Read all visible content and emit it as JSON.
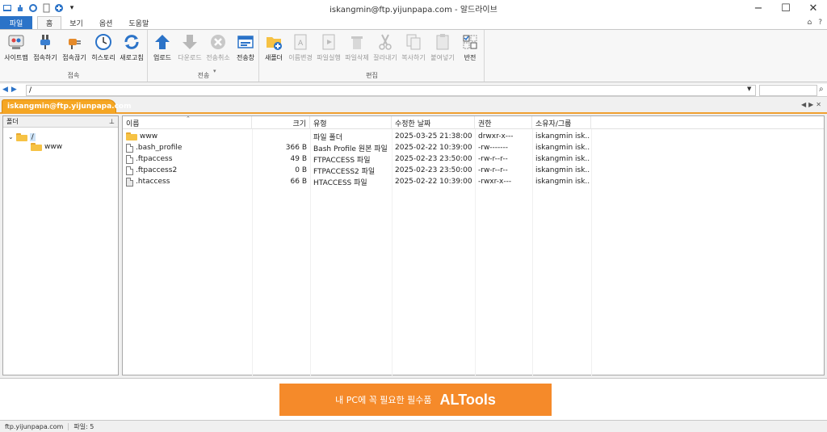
{
  "window": {
    "title": "iskangmin@ftp.yijunpapa.com - 알드라이브"
  },
  "ribbon_tabs": [
    "파일",
    "홈",
    "보기",
    "옵션",
    "도움말"
  ],
  "ribbon": {
    "groups": [
      {
        "label": "접속",
        "buttons": [
          "사이트맵",
          "접속하기",
          "접속끊기",
          "히스토리",
          "새로고침"
        ]
      },
      {
        "label": "전송",
        "buttons": [
          "업로드",
          "다운로드",
          "전송취소",
          "전송창"
        ]
      },
      {
        "label": "편집",
        "buttons": [
          "새폴더",
          "이름변경",
          "파일실행",
          "파일삭제",
          "잘라내기",
          "복사하기",
          "붙여넣기",
          "반전"
        ]
      }
    ]
  },
  "address": {
    "path": "/"
  },
  "session_tab": "iskangmin@ftp.yijunpapa.com",
  "folder_pane": {
    "header": "폴더",
    "pin": "ㅁ",
    "tree": [
      "/",
      "www"
    ]
  },
  "file_list": {
    "columns": [
      "이름",
      "크기",
      "유형",
      "수정한 날짜",
      "권한",
      "소유자/그룹"
    ],
    "rows": [
      {
        "icon": "folder",
        "name": "www",
        "size": "",
        "type": "파일 폴더",
        "modified": "2025-03-25 21:38:00",
        "perm": "drwxr-x---",
        "owner": "iskangmin isk..."
      },
      {
        "icon": "file",
        "name": ".bash_profile",
        "size": "366 B",
        "type": "Bash Profile 원본 파일",
        "modified": "2025-02-22 10:39:00",
        "perm": "-rw-------",
        "owner": "iskangmin isk..."
      },
      {
        "icon": "file",
        "name": ".ftpaccess",
        "size": "49 B",
        "type": "FTPACCESS 파일",
        "modified": "2025-02-23 23:50:00",
        "perm": "-rw-r--r--",
        "owner": "iskangmin isk..."
      },
      {
        "icon": "file",
        "name": ".ftpaccess2",
        "size": "0 B",
        "type": "FTPACCESS2 파일",
        "modified": "2025-02-23 23:50:00",
        "perm": "-rw-r--r--",
        "owner": "iskangmin isk..."
      },
      {
        "icon": "file-gray",
        "name": ".htaccess",
        "size": "66 B",
        "type": "HTACCESS 파일",
        "modified": "2025-02-22 10:39:00",
        "perm": "-rwxr-x---",
        "owner": "iskangmin isk..."
      }
    ]
  },
  "ad": {
    "text": "내 PC에 꼭 필요한 필수품",
    "logo": "ALTools",
    "color": "#f58a2a"
  },
  "status": {
    "host": "ftp.yijunpapa.com",
    "files": "파일: 5"
  },
  "colors": {
    "accent": "#2b73c8",
    "session_tab": "#f5a623"
  }
}
